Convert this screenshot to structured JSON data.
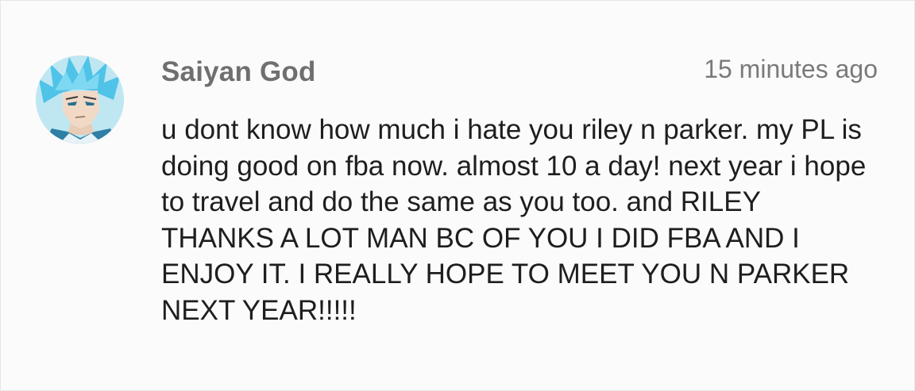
{
  "comment": {
    "author": "Saiyan God",
    "timestamp": "15 minutes ago",
    "text": "u dont know how much i hate you riley n parker. my PL is doing good on fba now. almost 10 a day! next year i hope to travel and do the same as you too. and RILEY THANKS A LOT MAN BC OF YOU I DID FBA AND I ENJOY IT. I REALLY HOPE TO MEET YOU N PARKER NEXT YEAR!!!!!",
    "avatar": {
      "icon": "anime-character-avatar",
      "colors": {
        "hair": "#4fc3e8",
        "background": "#bfe7f2",
        "skin": "#f1d9c6",
        "armor": "#2f7fa6"
      }
    }
  },
  "colors": {
    "background": "#fbfbfb",
    "author": "#6f6f6f",
    "timestamp": "#7a7a7a",
    "text": "#1e1e1e",
    "border": "#e6e6e6"
  }
}
